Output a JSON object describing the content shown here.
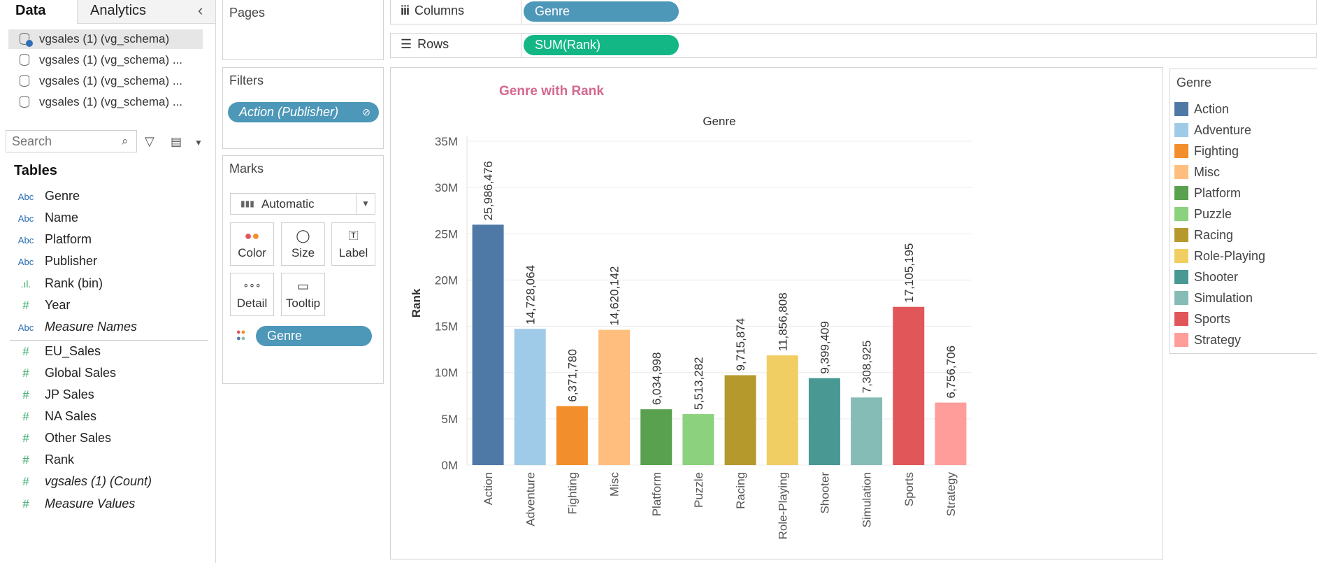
{
  "tabs": {
    "data": "Data",
    "analytics": "Analytics"
  },
  "data_sources": [
    "vgsales (1) (vg_schema)",
    "vgsales (1) (vg_schema) ...",
    "vgsales (1) (vg_schema) ...",
    "vgsales (1) (vg_schema) ..."
  ],
  "search": {
    "placeholder": "Search"
  },
  "tables_heading": "Tables",
  "fields": [
    {
      "type": "Abc",
      "label": "Genre",
      "italic": false
    },
    {
      "type": "Abc",
      "label": "Name",
      "italic": false
    },
    {
      "type": "Abc",
      "label": "Platform",
      "italic": false
    },
    {
      "type": "Abc",
      "label": "Publisher",
      "italic": false
    },
    {
      "type": "bin",
      "label": "Rank (bin)",
      "italic": false
    },
    {
      "type": "#",
      "label": "Year",
      "italic": false
    },
    {
      "type": "Abc",
      "label": "Measure Names",
      "italic": true
    },
    {
      "type": "#",
      "label": "EU_Sales",
      "italic": false
    },
    {
      "type": "#",
      "label": "Global Sales",
      "italic": false
    },
    {
      "type": "#",
      "label": "JP Sales",
      "italic": false
    },
    {
      "type": "#",
      "label": "NA Sales",
      "italic": false
    },
    {
      "type": "#",
      "label": "Other Sales",
      "italic": false
    },
    {
      "type": "#",
      "label": "Rank",
      "italic": false
    },
    {
      "type": "#",
      "label": "vgsales (1) (Count)",
      "italic": true
    },
    {
      "type": "#",
      "label": "Measure Values",
      "italic": true
    }
  ],
  "pages": {
    "title": "Pages"
  },
  "filters": {
    "title": "Filters",
    "pill": "Action (Publisher)"
  },
  "marks": {
    "title": "Marks",
    "type": "Automatic",
    "buttons": {
      "color": "Color",
      "size": "Size",
      "label": "Label",
      "detail": "Detail",
      "tooltip": "Tooltip"
    },
    "color_pill": "Genre"
  },
  "shelves": {
    "columns_label": "Columns",
    "columns_pill": "Genre",
    "rows_label": "Rows",
    "rows_pill": "SUM(Rank)"
  },
  "legend": {
    "title": "Genre"
  },
  "chart_data": {
    "type": "bar",
    "title": "Genre with Rank",
    "xlabel": "Genre",
    "ylabel": "Rank",
    "ylim": [
      0,
      35000000
    ],
    "y_ticks": [
      "0M",
      "5M",
      "10M",
      "15M",
      "20M",
      "25M",
      "30M",
      "35M"
    ],
    "categories": [
      "Action",
      "Adventure",
      "Fighting",
      "Misc",
      "Platform",
      "Puzzle",
      "Racing",
      "Role-Playing",
      "Shooter",
      "Simulation",
      "Sports",
      "Strategy"
    ],
    "values": [
      25986476,
      14728064,
      6371780,
      14620142,
      6034998,
      5513282,
      9715874,
      11856808,
      9399409,
      7308925,
      17105195,
      6756706
    ],
    "value_labels": [
      "25,986,476",
      "14,728,064",
      "6,371,780",
      "14,620,142",
      "6,034,998",
      "5,513,282",
      "9,715,874",
      "11,856,808",
      "9,399,409",
      "7,308,925",
      "17,105,195",
      "6,756,706"
    ],
    "colors": [
      "#4e79a7",
      "#a0cbe8",
      "#f28e2b",
      "#ffbe7d",
      "#59a14f",
      "#8cd17d",
      "#b6992d",
      "#f1ce63",
      "#499894",
      "#86bcb6",
      "#e15759",
      "#ff9d9a"
    ],
    "grid": true,
    "legend_position": "right"
  }
}
